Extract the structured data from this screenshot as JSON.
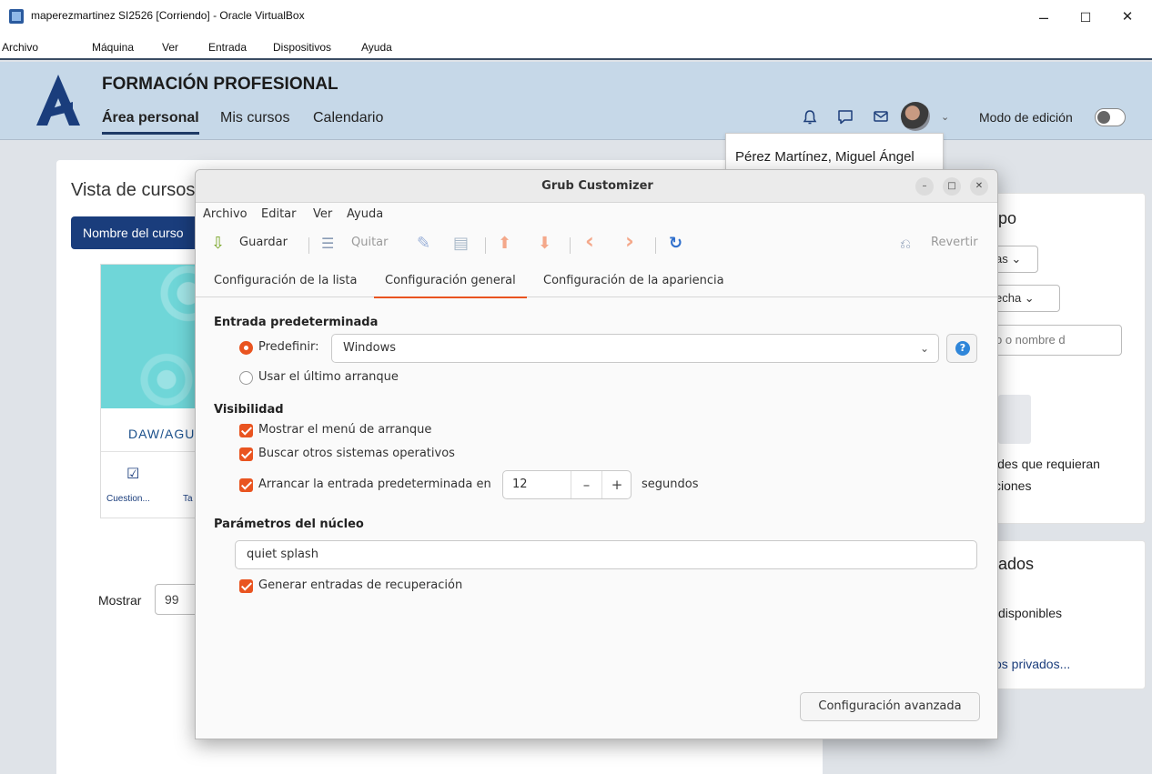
{
  "vbox": {
    "title": "maperezmartinez SI2526 [Corriendo] - Oracle VirtualBox",
    "menu": [
      "Archivo",
      "Máquina",
      "Ver",
      "Entrada",
      "Dispositivos",
      "Ayuda"
    ],
    "minimize": "–",
    "maximize": "☐",
    "close": "✕"
  },
  "moodle": {
    "site_name": "FORMACIÓN PROFESIONAL",
    "nav": [
      "Área personal",
      "Mis cursos",
      "Calendario"
    ],
    "icons": {
      "bell": "♫",
      "chat": "☐",
      "mail": "✉",
      "caret": "⌄"
    },
    "edit_mode_label": "Modo de edición",
    "user_tooltip": "Pérez Martínez, Miguel Ángel",
    "page_heading": "Vista de cursos",
    "sort_button": "Nombre del curso",
    "course_name": "DAW/AGU",
    "quiz_icon": "☑",
    "quiz_label": "Cuestion...",
    "task_label": "Ta",
    "show_label": "Mostrar",
    "show_value": "99",
    "right": {
      "timeline_title": "po",
      "filter_1": "as ⌄",
      "filter_2": "echa ⌄",
      "search_placeholder": "o o nombre d",
      "empty_line_1": "ides que requieran",
      "empty_line_2": "ciones",
      "private_title": "ados",
      "private_empty": "disponibles",
      "private_link": "os privados..."
    }
  },
  "grub": {
    "title": "Grub Customizer",
    "min": "–",
    "max": "□",
    "close": "✕",
    "menu": [
      "Archivo",
      "Editar",
      "Ver",
      "Ayuda"
    ],
    "toolbar": {
      "save": "Guardar",
      "remove": "Quitar",
      "revert": "Revertir",
      "icons": {
        "save": "⇩",
        "remove": "☰",
        "edit": "✎",
        "new": "▤",
        "up": "⬆",
        "down": "⬇",
        "left": "‹",
        "right": "›",
        "refresh": "↻",
        "revert": "⎌"
      }
    },
    "tabs": [
      "Configuración de la lista",
      "Configuración general",
      "Configuración de la apariencia"
    ],
    "default_entry": {
      "title": "Entrada predeterminada",
      "predefined_label": "Predefinir:",
      "predefined_value": "Windows",
      "caret": "⌄",
      "last_boot_label": "Usar el último arranque"
    },
    "visibility": {
      "title": "Visibilidad",
      "show_menu": "Mostrar el menú de arranque",
      "search_os": "Buscar otros sistemas operativos",
      "boot_default_in": "Arrancar la entrada predeterminada en",
      "timeout": "12",
      "minus": "–",
      "plus": "+",
      "seconds": "segundos"
    },
    "kernel": {
      "title": "Parámetros del núcleo",
      "params": "quiet splash",
      "recovery": "Generar entradas de recuperación"
    },
    "advanced_button": "Configuración avanzada",
    "accent": "#e95420"
  }
}
